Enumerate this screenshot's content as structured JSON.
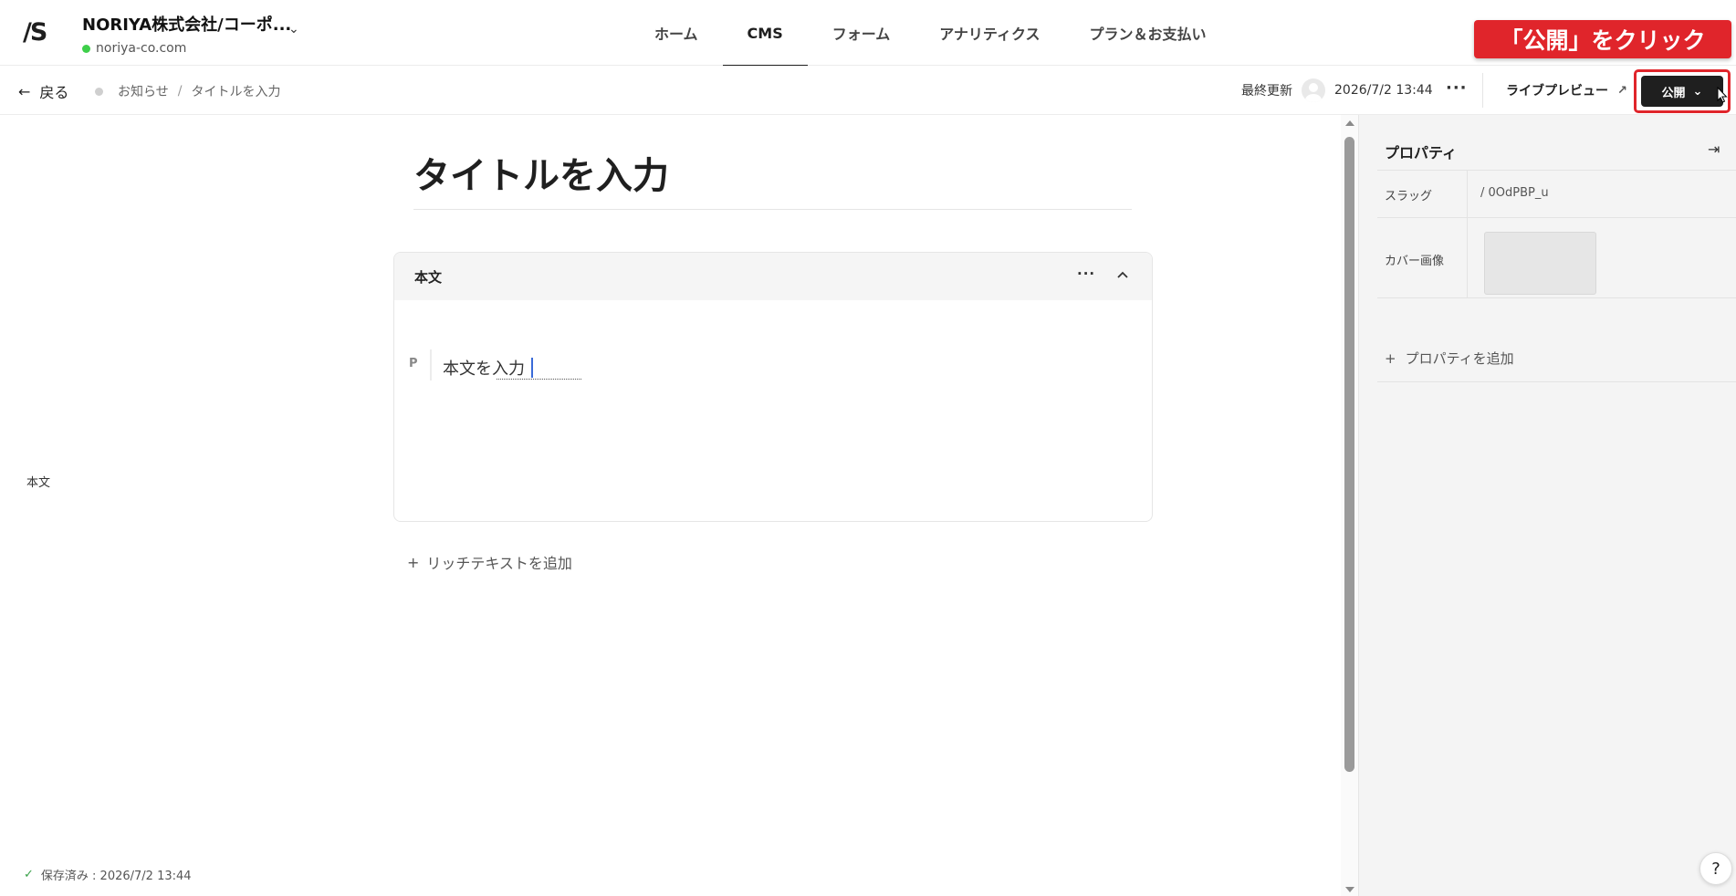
{
  "header": {
    "logo_text": "/S",
    "site_name": "NORIYA株式会社/コーポ...",
    "site_domain": "noriya-co.com",
    "nav": [
      {
        "label": "ホーム",
        "active": false
      },
      {
        "label": "CMS",
        "active": true
      },
      {
        "label": "フォーム",
        "active": false
      },
      {
        "label": "アナリティクス",
        "active": false
      },
      {
        "label": "プラン＆お支払い",
        "active": false
      }
    ],
    "callout_text": "「公開」をクリック"
  },
  "subbar": {
    "back_label": "戻る",
    "breadcrumb": [
      "お知らせ",
      "タイトルを入力"
    ],
    "breadcrumb_sep": "/",
    "last_updated_label": "最終更新",
    "last_updated_value": "2026/7/2 13:44",
    "more": "···",
    "live_preview_label": "ライブプレビュー",
    "publish_label": "公開"
  },
  "editor": {
    "left_label": "本文",
    "title_placeholder": "タイトルを入力",
    "block_title": "本文",
    "block_more": "···",
    "paragraph_marker": "P",
    "paragraph_text": "本文を入力",
    "add_rich_text": "リッチテキストを追加",
    "saved_status": "保存済み : 2026/7/2 13:44"
  },
  "panel": {
    "title": "プロパティ",
    "rows": [
      {
        "label": "スラッグ",
        "value": "/  0OdPBP_u"
      },
      {
        "label": "カバー画像",
        "value": ""
      }
    ],
    "add_property": "プロパティを追加"
  },
  "help_label": "?",
  "colors": {
    "accent_red": "#e0252b",
    "publish_bg": "#1f1f1f",
    "online_green": "#3ecf4a",
    "caret_blue": "#3a6bd8"
  }
}
